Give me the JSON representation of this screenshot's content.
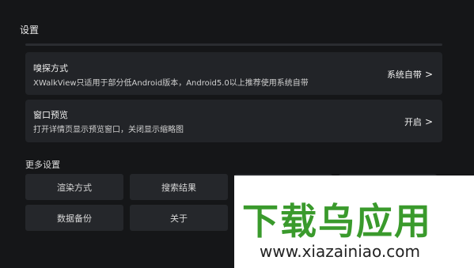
{
  "header": {
    "title": "设置"
  },
  "settings": [
    {
      "title": "嗅探方式",
      "description": "XWalkView只适用于部分低Android版本，Android5.0以上推荐使用系统自带",
      "value": "系统自带"
    },
    {
      "title": "窗口预览",
      "description": "打开详情页显示预览窗口，关闭显示缩略图",
      "value": "开启"
    }
  ],
  "more_settings": {
    "title": "更多设置",
    "buttons": [
      "渲染方式",
      "搜索结果",
      "",
      "",
      "数据备份",
      "关于"
    ]
  },
  "watermark": {
    "logo": "下载乌应用",
    "url": "www.xiazainiao.com"
  },
  "icons": {
    "chevron": "chevron-right-icon"
  },
  "colors": {
    "background": "#151618",
    "card": "#222428",
    "button": "#25272b",
    "watermark_green": "#3a9a2c"
  }
}
